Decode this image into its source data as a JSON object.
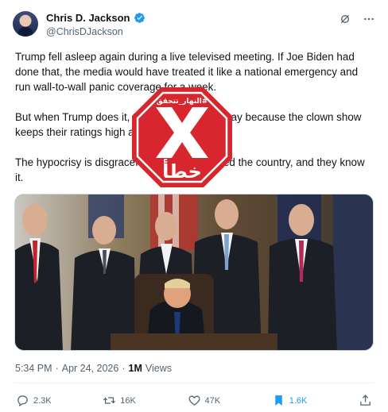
{
  "author": {
    "display_name": "Chris D. Jackson",
    "handle": "@ChrisDJackson",
    "verified": true,
    "verified_color": "#1d9bf0"
  },
  "tweet": {
    "paragraphs": [
      "Trump fell asleep again during a live televised meeting. If Joe Biden had done that, the media would have treated it like a national emergency and run wall-to-wall panic coverage for a week.",
      "But when Trump does it, they look the other way because the clown show keeps their ratings high and their pockets full.",
      "The hypocrisy is disgraceful. Trump has ruined the country, and they know it."
    ]
  },
  "meta": {
    "time": "5:34 PM",
    "separator": "·",
    "date": "Apr 24, 2026",
    "views_count": "1M",
    "views_label": "Views"
  },
  "actions": {
    "replies": "2.3K",
    "reposts": "16K",
    "likes": "47K",
    "bookmarks": "1.6K"
  },
  "stamp": {
    "header_text": "النهار_تتحقق#",
    "verdict_text": "خطأ",
    "color": "#d7262e"
  },
  "icons": [
    "verified-badge-icon",
    "grok-icon",
    "more-icon",
    "reply-icon",
    "repost-icon",
    "like-icon",
    "bookmark-icon",
    "share-icon",
    "x-mark-icon"
  ]
}
